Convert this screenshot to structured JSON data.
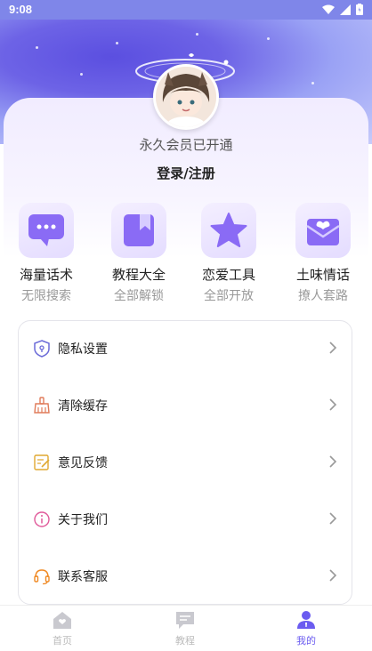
{
  "status_bar": {
    "time": "9:08"
  },
  "profile": {
    "vip_status": "永久会员已开通",
    "login_label": "登录/注册"
  },
  "features": [
    {
      "title": "海量话术",
      "subtitle": "无限搜索",
      "icon": "chat-bubble-icon"
    },
    {
      "title": "教程大全",
      "subtitle": "全部解锁",
      "icon": "bookmark-book-icon"
    },
    {
      "title": "恋爱工具",
      "subtitle": "全部开放",
      "icon": "star-icon"
    },
    {
      "title": "土味情话",
      "subtitle": "撩人套路",
      "icon": "heart-envelope-icon"
    }
  ],
  "menu": [
    {
      "label": "隐私设置",
      "icon": "shield-icon"
    },
    {
      "label": "清除缓存",
      "icon": "broom-icon"
    },
    {
      "label": "意见反馈",
      "icon": "feedback-icon"
    },
    {
      "label": "关于我们",
      "icon": "info-icon"
    },
    {
      "label": "联系客服",
      "icon": "headset-icon"
    }
  ],
  "tabbar": [
    {
      "label": "首页",
      "icon": "home-icon",
      "active": false
    },
    {
      "label": "教程",
      "icon": "message-icon",
      "active": false
    },
    {
      "label": "我的",
      "icon": "user-icon",
      "active": true
    }
  ],
  "colors": {
    "accent": "#6b5cf0",
    "status_bar": "#7f86e9",
    "tab_inactive": "#bbbbbb"
  }
}
